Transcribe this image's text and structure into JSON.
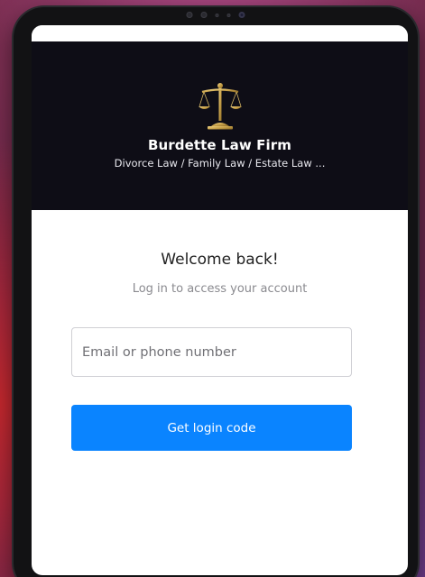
{
  "header": {
    "logo_icon": "scales-of-justice-icon",
    "firm_name": "Burdette Law Firm",
    "tagline": "Divorce Law / Family Law / Estate Law ..."
  },
  "login": {
    "heading": "Welcome back!",
    "subheading": "Log in to access your account",
    "email_placeholder": "Email or phone number",
    "email_value": "",
    "submit_label": "Get login code"
  },
  "colors": {
    "header_bg": "#0e0d16",
    "button_bg": "#0a84ff",
    "logo_gold": "#c9a24a"
  }
}
